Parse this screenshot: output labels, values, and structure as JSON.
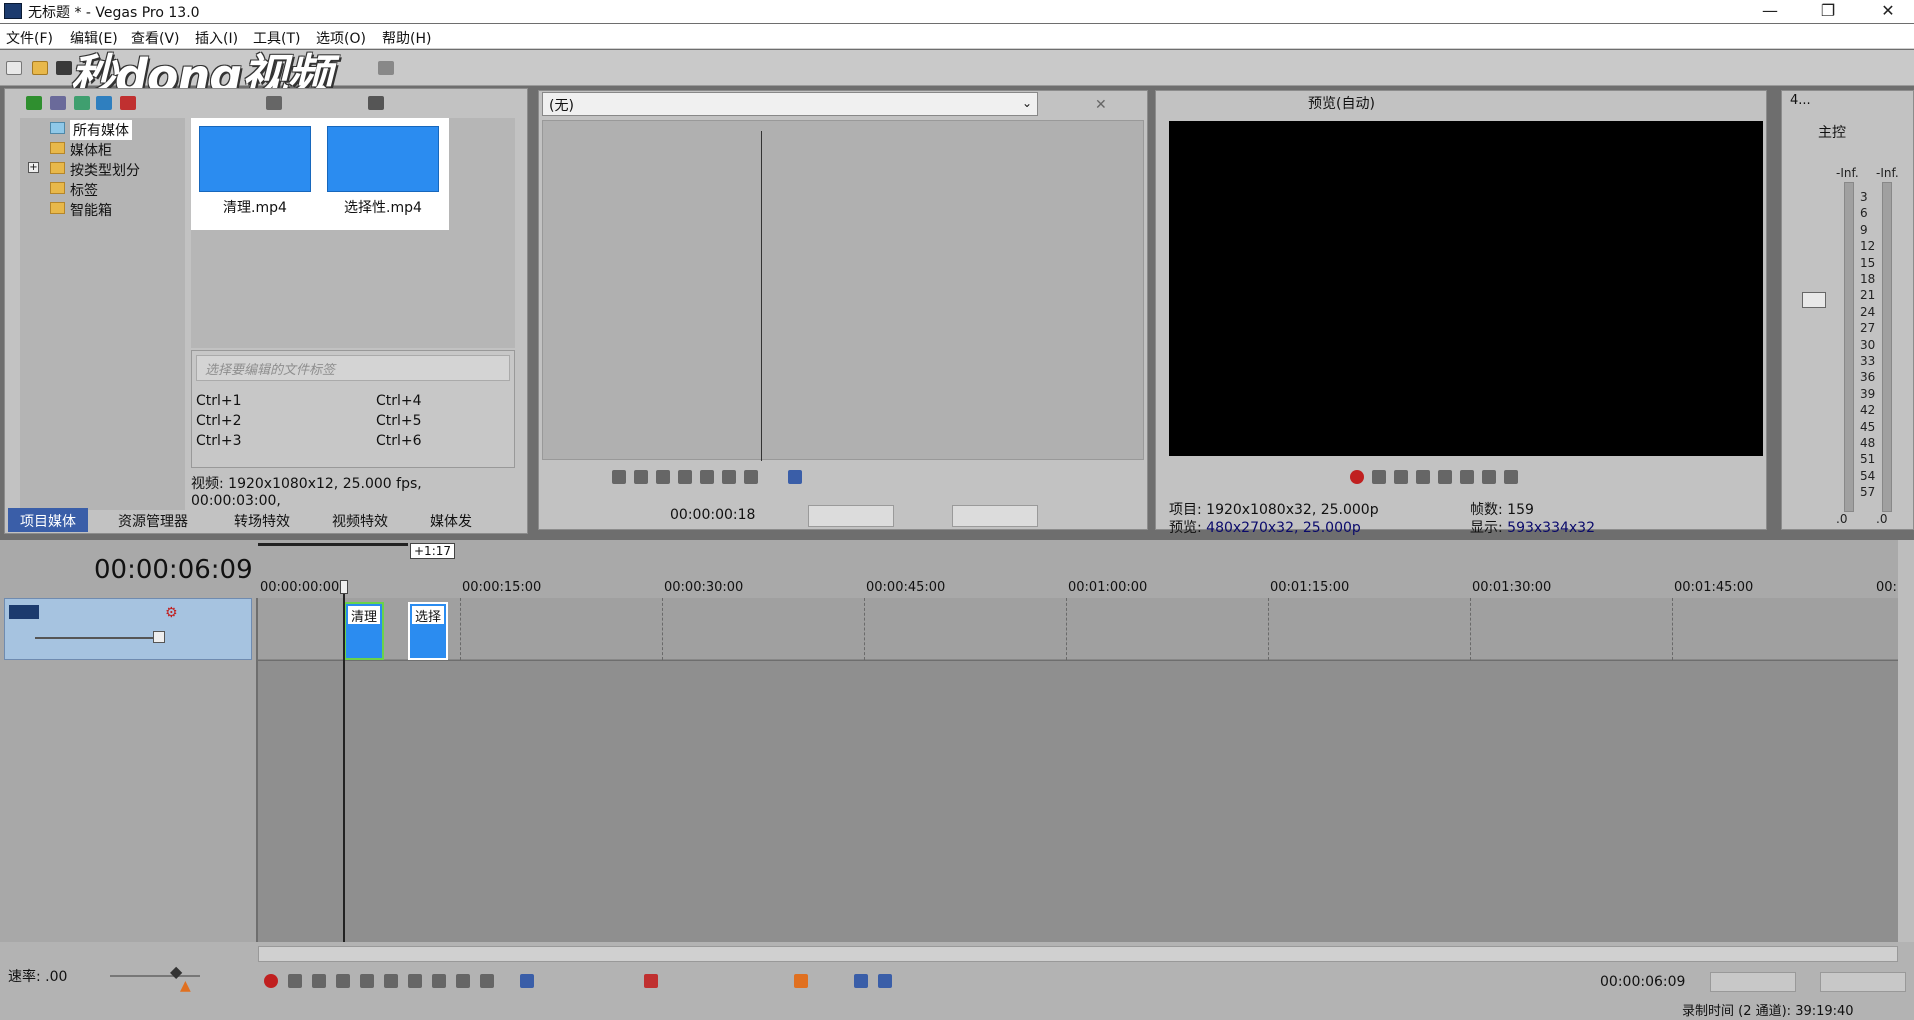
{
  "window": {
    "title": "无标题 * - Vegas Pro 13.0",
    "controls": [
      "—",
      "❐",
      "✕"
    ]
  },
  "menu": [
    "文件(F)",
    "编辑(E)",
    "查看(V)",
    "插入(I)",
    "工具(T)",
    "选项(O)",
    "帮助(H)"
  ],
  "watermark": "秒dong视频",
  "explorer": {
    "tree": [
      {
        "label": "所有媒体",
        "selected": true
      },
      {
        "label": "媒体柜"
      },
      {
        "label": "按类型划分",
        "expandable": true
      },
      {
        "label": "标签"
      },
      {
        "label": "智能箱"
      }
    ],
    "media": [
      {
        "name": "清理.mp4"
      },
      {
        "name": "选择性.mp4"
      }
    ],
    "tag_placeholder": "选择要编辑的文件标签",
    "shortcuts": [
      "Ctrl+1",
      "Ctrl+4",
      "Ctrl+2",
      "Ctrl+5",
      "Ctrl+3",
      "Ctrl+6"
    ],
    "media_info": "视频: 1920x1080x12, 25.000 fps, 00:00:03:00,",
    "tabs": [
      "项目媒体",
      "资源管理器",
      "转场特效",
      "视频特效",
      "媒体发"
    ]
  },
  "trimmer": {
    "source": "(无)",
    "timecode": "00:00:00:18"
  },
  "preview": {
    "mode": "预览(自动)",
    "project_label": "项目:",
    "project_value": "1920x1080x32, 25.000p",
    "preview_label": "预览:",
    "preview_value": "480x270x32, 25.000p",
    "frames_label": "帧数:",
    "frames_value": "159",
    "display_label": "显示:",
    "display_value": "593x334x32"
  },
  "mixer": {
    "title": "主控",
    "header": "4...",
    "inf_left": "-Inf.",
    "inf_right": "-Inf.",
    "scale": [
      "3",
      "6",
      "9",
      "12",
      "15",
      "18",
      "21",
      "24",
      "27",
      "30",
      "33",
      "36",
      "39",
      "42",
      "45",
      "48",
      "51",
      "54",
      "57"
    ],
    "bottom_left": ".0",
    "bottom_right": ".0"
  },
  "timeline": {
    "cursor_time": "00:00:06:09",
    "offset_badge": "+1:17",
    "ruler": [
      "00:00:00:00",
      "00:00:15:00",
      "00:00:30:00",
      "00:00:45:00",
      "00:01:00:00",
      "00:01:15:00",
      "00:01:30:00",
      "00:01:45:00",
      "00:"
    ],
    "clips": [
      {
        "label": "清理"
      },
      {
        "label": "选择"
      }
    ],
    "rate_label": "速率: .00",
    "bottom_timecode": "00:00:06:09",
    "record_time": "录制时间 (2 通道): 39:19:40"
  }
}
